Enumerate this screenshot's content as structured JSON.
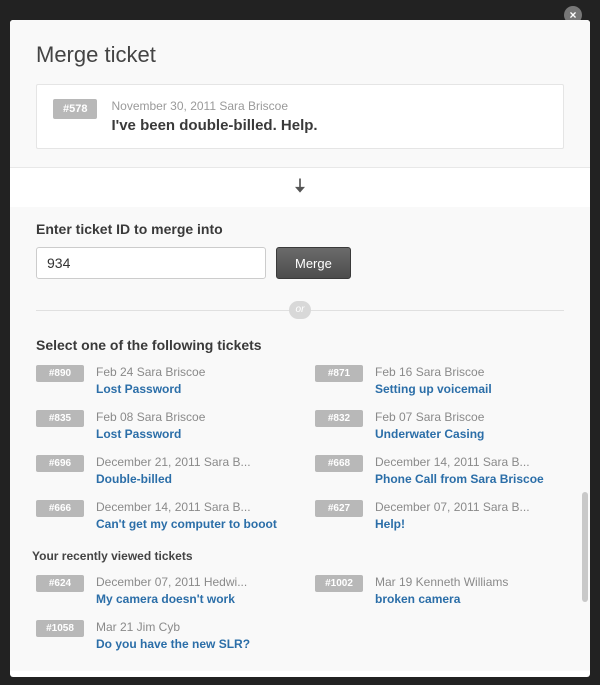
{
  "close_glyph": "×",
  "title": "Merge ticket",
  "source": {
    "badge": "#578",
    "meta": "November 30, 2011 Sara Briscoe",
    "subject": "I've been double-billed. Help."
  },
  "input_label": "Enter ticket ID to merge into",
  "input_value": "934",
  "merge_button": "Merge",
  "or_label": "or",
  "select_label": "Select one of the following tickets",
  "tickets": [
    {
      "badge": "#890",
      "meta": "Feb 24 Sara Briscoe",
      "subject": "Lost Password"
    },
    {
      "badge": "#871",
      "meta": "Feb 16 Sara Briscoe",
      "subject": "Setting up voicemail"
    },
    {
      "badge": "#835",
      "meta": "Feb 08 Sara Briscoe",
      "subject": "Lost Password"
    },
    {
      "badge": "#832",
      "meta": "Feb 07 Sara Briscoe",
      "subject": "Underwater Casing"
    },
    {
      "badge": "#696",
      "meta": "December 21, 2011 Sara B...",
      "subject": "Double-billed"
    },
    {
      "badge": "#668",
      "meta": "December 14, 2011 Sara B...",
      "subject": "Phone Call from Sara Briscoe"
    },
    {
      "badge": "#666",
      "meta": "December 14, 2011 Sara B...",
      "subject": "Can't get my computer to booot"
    },
    {
      "badge": "#627",
      "meta": "December 07, 2011 Sara B...",
      "subject": "Help!"
    }
  ],
  "recent_label": "Your recently viewed tickets",
  "recent": [
    {
      "badge": "#624",
      "meta": "December 07, 2011 Hedwi...",
      "subject": "My camera doesn't work"
    },
    {
      "badge": "#1002",
      "meta": "Mar 19 Kenneth Williams",
      "subject": "broken camera"
    },
    {
      "badge": "#1058",
      "meta": "Mar 21 Jim Cyb",
      "subject": "Do you have the new SLR?"
    }
  ]
}
